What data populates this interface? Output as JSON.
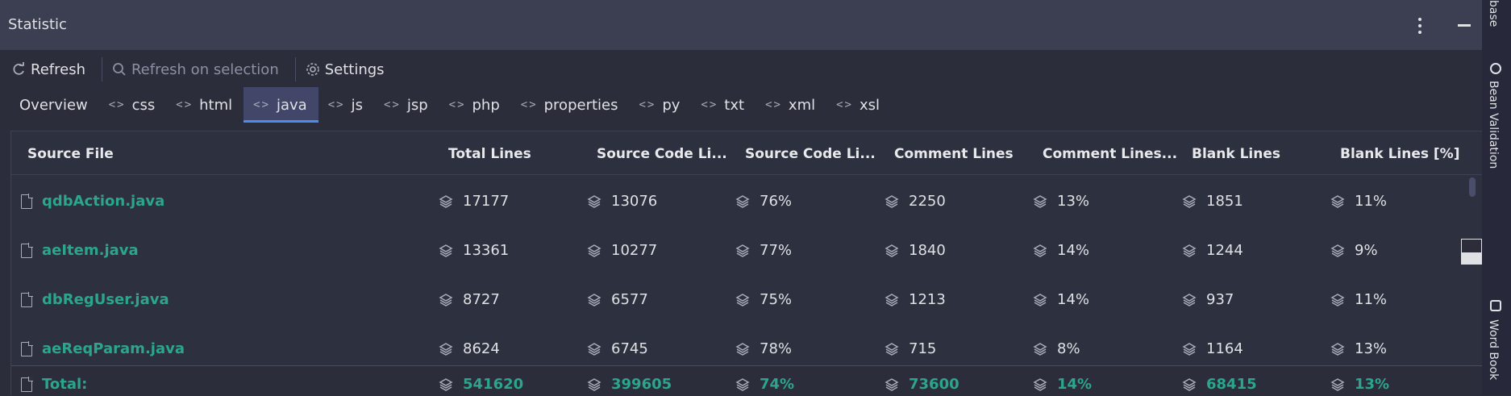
{
  "window": {
    "title": "Statistic"
  },
  "toolbar": {
    "refresh_label": "Refresh",
    "refresh_selection_label": "Refresh on selection",
    "settings_label": "Settings"
  },
  "tabs": [
    {
      "label": "Overview",
      "icon": null
    },
    {
      "label": "css",
      "icon": "code-icon"
    },
    {
      "label": "html",
      "icon": "code-icon"
    },
    {
      "label": "java",
      "icon": "code-icon",
      "active": true
    },
    {
      "label": "js",
      "icon": "code-icon"
    },
    {
      "label": "jsp",
      "icon": "code-icon"
    },
    {
      "label": "php",
      "icon": "code-icon"
    },
    {
      "label": "properties",
      "icon": "code-icon"
    },
    {
      "label": "py",
      "icon": "code-icon"
    },
    {
      "label": "txt",
      "icon": "code-icon"
    },
    {
      "label": "xml",
      "icon": "code-icon"
    },
    {
      "label": "xsl",
      "icon": "code-icon"
    }
  ],
  "table": {
    "headers": [
      "Source File",
      "Total Lines",
      "Source Code Li...",
      "Source Code Li...",
      "Comment Lines",
      "Comment Lines...",
      "Blank Lines",
      "Blank Lines [%]"
    ],
    "rows": [
      {
        "file": "qdbAction.java",
        "total": "17177",
        "src": "13076",
        "src_pct": "76%",
        "comment": "2250",
        "comment_pct": "13%",
        "blank": "1851",
        "blank_pct": "11%"
      },
      {
        "file": "aeItem.java",
        "total": "13361",
        "src": "10277",
        "src_pct": "77%",
        "comment": "1840",
        "comment_pct": "14%",
        "blank": "1244",
        "blank_pct": "9%"
      },
      {
        "file": "dbRegUser.java",
        "total": "8727",
        "src": "6577",
        "src_pct": "75%",
        "comment": "1213",
        "comment_pct": "14%",
        "blank": "937",
        "blank_pct": "11%"
      },
      {
        "file": "aeReqParam.java",
        "total": "8624",
        "src": "6745",
        "src_pct": "78%",
        "comment": "715",
        "comment_pct": "8%",
        "blank": "1164",
        "blank_pct": "13%"
      }
    ],
    "total": {
      "file": "Total:",
      "total": "541620",
      "src": "399605",
      "src_pct": "74%",
      "comment": "73600",
      "comment_pct": "14%",
      "blank": "68415",
      "blank_pct": "13%"
    }
  },
  "side_panel": {
    "labels": [
      "base",
      "Bean Validation",
      "Word Book"
    ]
  },
  "colors": {
    "accent_green": "#2ca58d",
    "active_tab": "#424769",
    "tab_underline": "#4a8cf0"
  }
}
